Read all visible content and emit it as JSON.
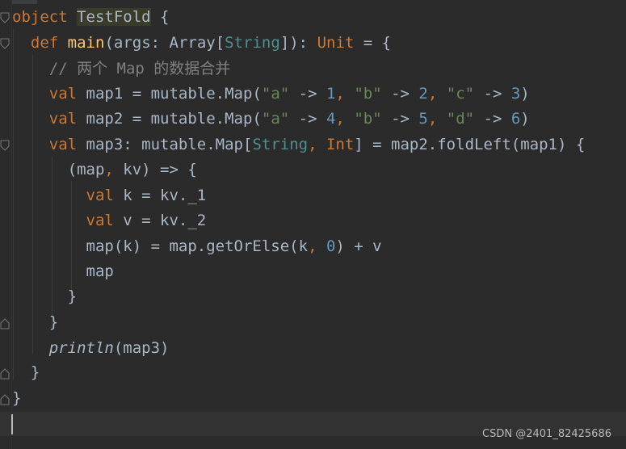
{
  "code": {
    "l1": {
      "kw": "object",
      "name": "TestFold",
      "rest": " {"
    },
    "l2": {
      "kw": "def",
      "fn": "main",
      "p1": "(args: Array[",
      "t1": "String",
      "p2": "]): ",
      "t2": "Unit",
      "p3": " = {"
    },
    "l3": {
      "comment": "// 两个 Map 的数据合并"
    },
    "l4": {
      "kw": "val",
      "a": " map1 = mutable.Map(",
      "s1": "\"a\"",
      "ar1": " -> ",
      "n1": "1",
      "c1": ", ",
      "s2": "\"b\"",
      "ar2": " -> ",
      "n2": "2",
      "c2": ", ",
      "s3": "\"c\"",
      "ar3": " -> ",
      "n3": "3",
      "end": ")"
    },
    "l5": {
      "kw": "val",
      "a": " map2 = mutable.Map(",
      "s1": "\"a\"",
      "ar1": " -> ",
      "n1": "4",
      "c1": ", ",
      "s2": "\"b\"",
      "ar2": " -> ",
      "n2": "5",
      "c2": ", ",
      "s3": "\"d\"",
      "ar3": " -> ",
      "n3": "6",
      "end": ")"
    },
    "l6": {
      "kw": "val",
      "a": " map3: mutable.Map[",
      "t1": "String",
      "c1": ", ",
      "t2": "Int",
      "b": "] = map2.foldLeft(map1) {"
    },
    "l7": {
      "a": "(map",
      "c1": ", ",
      "b": "kv) => {"
    },
    "l8": {
      "kw": "val",
      "a": " k = kv._1"
    },
    "l9": {
      "kw": "val",
      "a": " v = kv._2"
    },
    "l10": {
      "a": "map(k) = map.getOrElse(k",
      "c1": ", ",
      "n1": "0",
      "b": ") + v"
    },
    "l11": {
      "a": "map"
    },
    "l12": {
      "a": "}"
    },
    "l13": {
      "a": "}"
    },
    "l14": {
      "fn": "println",
      "a": "(map3)"
    },
    "l15": {
      "a": "}"
    },
    "l16": {
      "a": "}"
    }
  },
  "watermark": "CSDN @2401_82425686",
  "colors": {
    "background": "#2b2b2b",
    "keyword": "#cc7832",
    "string": "#6a8759",
    "number": "#6897bb",
    "comment": "#808080",
    "function": "#ffc66d"
  }
}
